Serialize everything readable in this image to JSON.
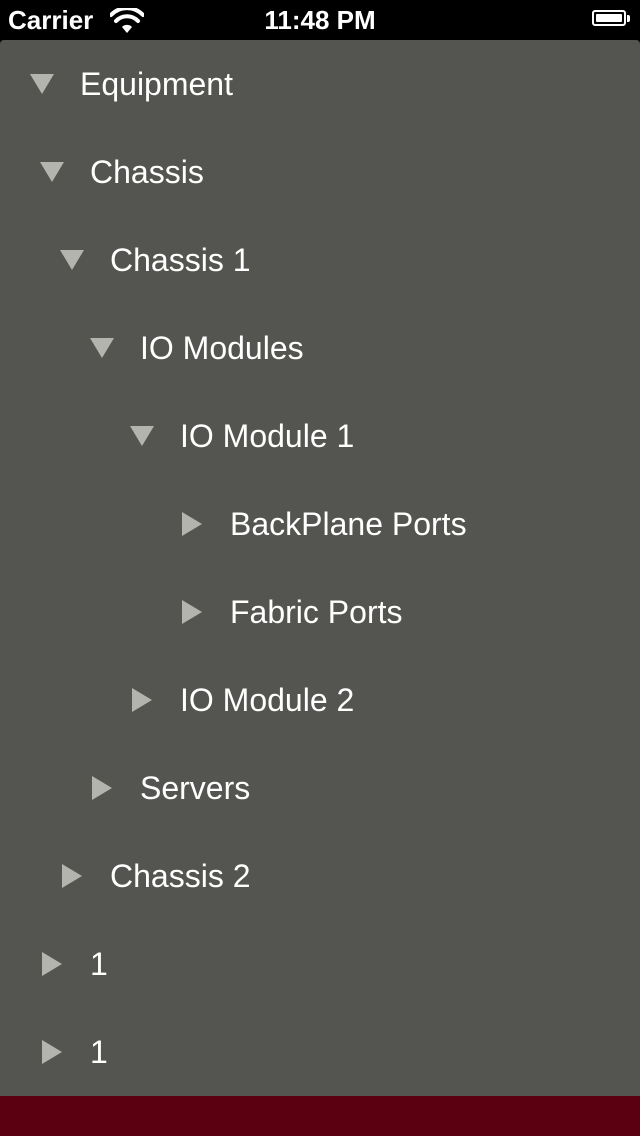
{
  "status_bar": {
    "carrier": "Carrier",
    "time": "11:48 PM",
    "battery_level": 1.0
  },
  "tree": {
    "items": [
      {
        "label": "Equipment",
        "level": 0,
        "expanded": true
      },
      {
        "label": "Chassis",
        "level": 1,
        "expanded": true
      },
      {
        "label": "Chassis 1",
        "level": 2,
        "expanded": true
      },
      {
        "label": "IO Modules",
        "level": 3,
        "expanded": true
      },
      {
        "label": "IO Module 1",
        "level": 4,
        "expanded": true
      },
      {
        "label": "BackPlane Ports",
        "level": 5,
        "expanded": false
      },
      {
        "label": "Fabric Ports",
        "level": 5,
        "expanded": false
      },
      {
        "label": "IO Module 2",
        "level": 4,
        "expanded": false
      },
      {
        "label": "Servers",
        "level": 3,
        "expanded": false
      },
      {
        "label": "Chassis 2",
        "level": 2,
        "expanded": false
      },
      {
        "label": "1",
        "level": 1,
        "expanded": false
      },
      {
        "label": "1",
        "level": 1,
        "expanded": false
      }
    ]
  },
  "colors": {
    "background": "#545550",
    "disclosure": "#b4b4ae",
    "text": "#ffffff",
    "footer": "#5a0010"
  }
}
